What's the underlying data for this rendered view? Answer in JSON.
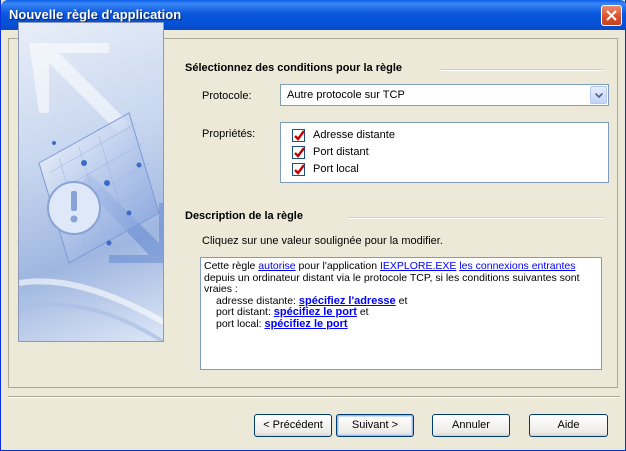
{
  "window": {
    "title": "Nouvelle règle d'application"
  },
  "conditions": {
    "heading": "Sélectionnez des conditions pour la règle",
    "protocol_label": "Protocole:",
    "protocol_value": "Autre protocole sur TCP",
    "properties_label": "Propriétés:",
    "properties": [
      {
        "label": "Adresse distante",
        "checked": true
      },
      {
        "label": "Port distant",
        "checked": true
      },
      {
        "label": "Port local",
        "checked": true
      }
    ]
  },
  "description": {
    "heading": "Description de la règle",
    "hint": "Cliquez sur une valeur soulignée pour la modifier.",
    "t1": "Cette règle ",
    "l_autorise": "autorise",
    "t2": " pour l'application ",
    "l_app": "IEXPLORE.EXE",
    "t3": " ",
    "l_conn": "les connexions entrantes",
    "t4": " depuis un ordinateur distant via le protocole TCP, si les conditions suivantes sont vraies :",
    "r1_label": "adresse distante: ",
    "r1_link": "spécifiez l'adresse",
    "r1_tail": " et",
    "r2_label": "port distant: ",
    "r2_link": "spécifiez le port",
    "r2_tail": " et",
    "r3_label": "port local: ",
    "r3_link": "spécifiez le port"
  },
  "buttons": {
    "previous": "< Précédent",
    "next": "Suivant >",
    "cancel": "Annuler",
    "help": "Aide"
  },
  "colors": {
    "titlebar": "#0551d6",
    "link": "#0000ff",
    "check": "#c00000"
  }
}
